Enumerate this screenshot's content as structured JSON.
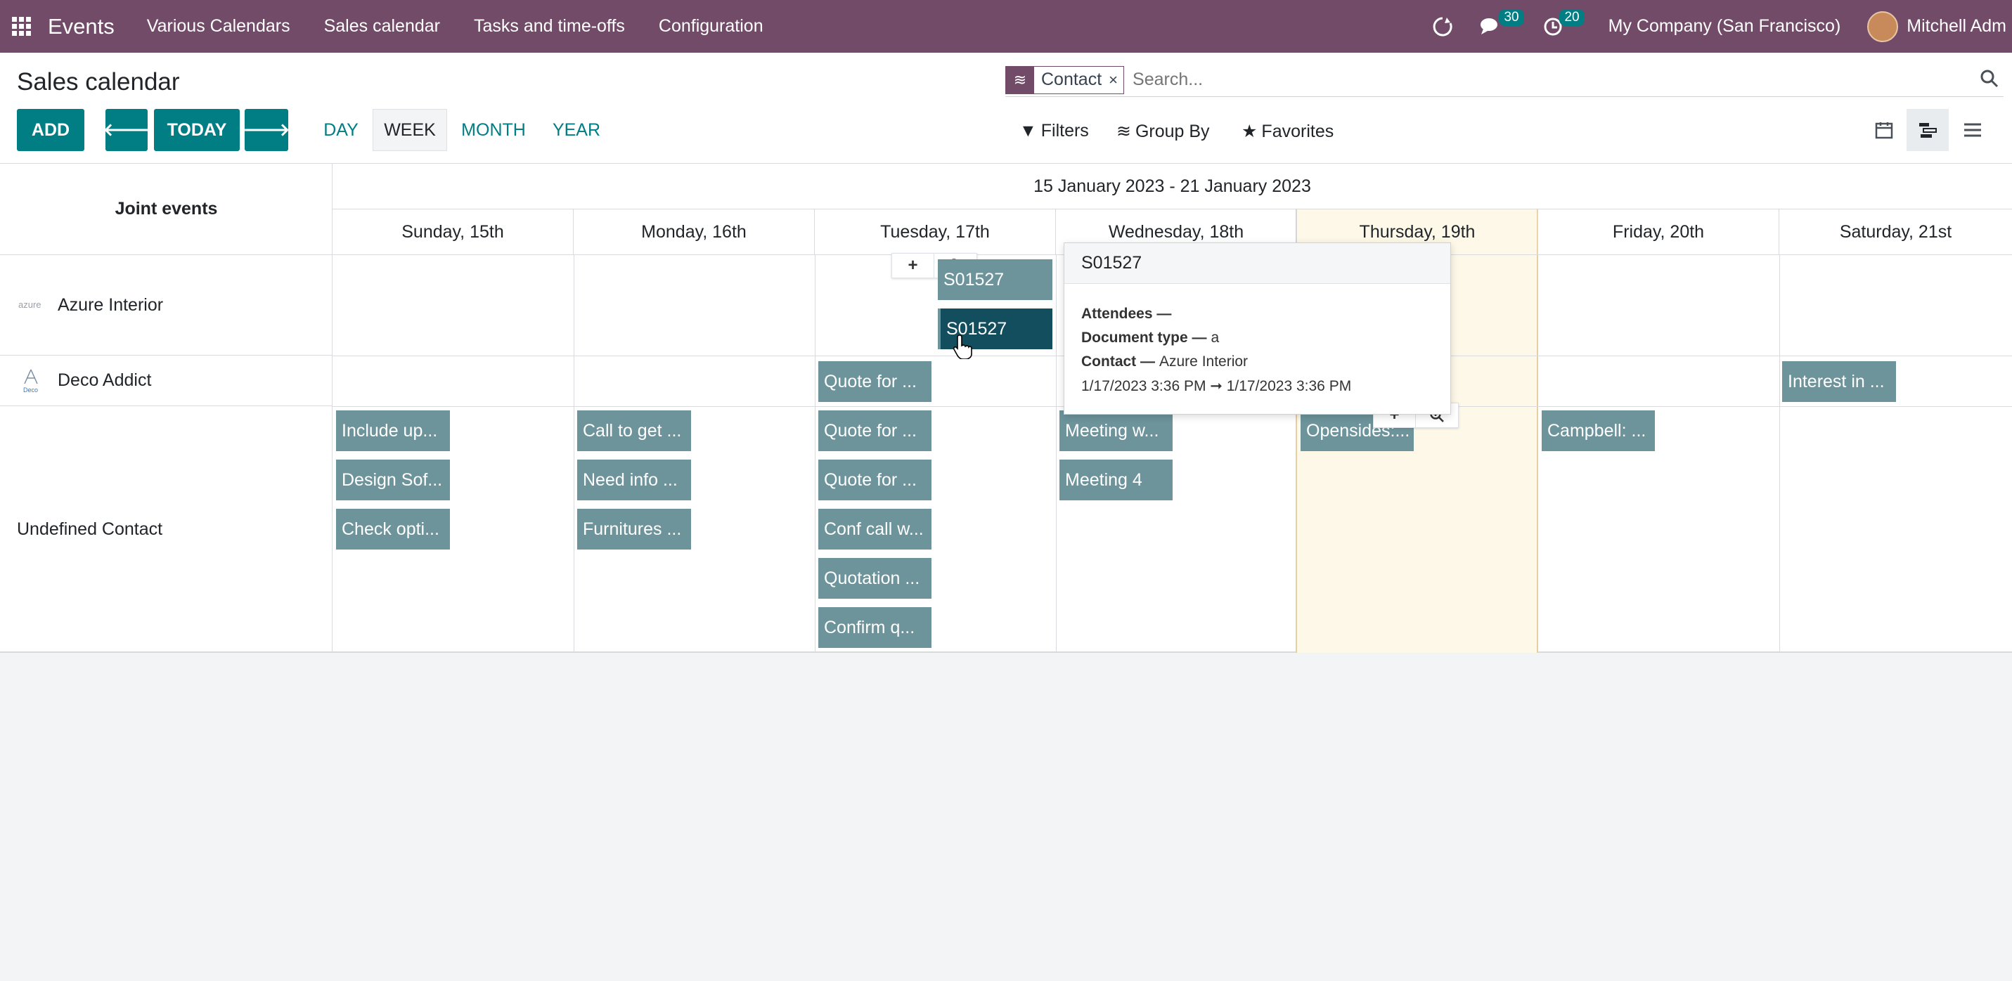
{
  "navbar": {
    "brand": "Events",
    "items": [
      "Various Calendars",
      "Sales calendar",
      "Tasks and time-offs",
      "Configuration"
    ],
    "messages_count": "30",
    "activities_count": "20",
    "company": "My Company (San Francisco)",
    "user": "Mitchell Adm"
  },
  "control": {
    "title": "Sales calendar",
    "add_label": "ADD",
    "today_label": "TODAY",
    "scales": [
      "DAY",
      "WEEK",
      "MONTH",
      "YEAR"
    ],
    "active_scale": "WEEK",
    "facet_label": "Contact",
    "search_placeholder": "Search...",
    "filters_label": "Filters",
    "groupby_label": "Group By",
    "favorites_label": "Favorites"
  },
  "calendar": {
    "joint_label": "Joint events",
    "range_title": "15 January 2023 - 21 January 2023",
    "days": [
      "Sunday, 15th",
      "Monday, 16th",
      "Tuesday, 17th",
      "Wednesday, 18th",
      "Thursday, 19th",
      "Friday, 20th",
      "Saturday, 21st"
    ],
    "rows": [
      {
        "label": "Azure Interior",
        "logo": "azure"
      },
      {
        "label": "Deco Addict",
        "logo": "deco"
      },
      {
        "label": "Undefined Contact",
        "logo": ""
      }
    ],
    "events": {
      "azure_1": "S01527",
      "azure_2": "S01527",
      "deco_tue": "Quote for ...",
      "deco_sat": "Interest in ...",
      "sun_1": "Include up...",
      "sun_2": "Design Sof...",
      "sun_3": "Check opti...",
      "mon_1": "Call to get ...",
      "mon_2": "Need info ...",
      "mon_3": "Furnitures ...",
      "tue_1": "Quote for ...",
      "tue_2": "Quote for ...",
      "tue_3": "Conf call w...",
      "tue_4": "Quotation ...",
      "tue_5": "Confirm q...",
      "wed_1": "Meeting w...",
      "wed_2": "Meeting 4",
      "thu_1": "Opensides:...",
      "fri_1": "Campbell: ..."
    }
  },
  "popover": {
    "title": "S01527",
    "attendees_label": "Attendees —",
    "doctype_label": "Document type —",
    "doctype_value": "a",
    "contact_label": "Contact —",
    "contact_value": "Azure Interior",
    "date_range": "1/17/2023 3:36 PM ➞ 1/17/2023 3:36 PM"
  },
  "colors": {
    "navbar": "#714b67",
    "accent": "#017e84",
    "event": "#6d939b",
    "event_selected": "#134e5e",
    "today_bg": "#fdf8e8"
  }
}
